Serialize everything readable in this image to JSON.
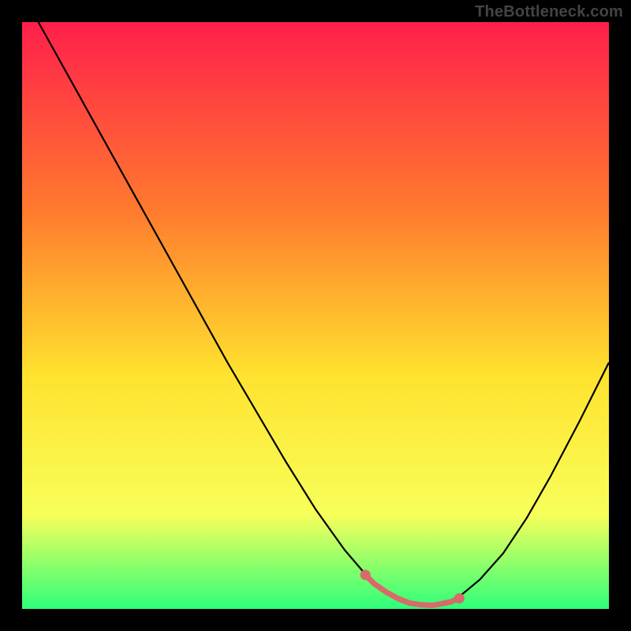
{
  "watermark": "TheBottleneck.com",
  "colors": {
    "background": "#000000",
    "gradient_top": "#ff1f4b",
    "gradient_mid1": "#ff7a2e",
    "gradient_mid2": "#ffe22e",
    "gradient_mid3": "#f7ff5a",
    "gradient_bottom": "#2eff7a",
    "curve": "#000000",
    "accent": "#d86a6a"
  },
  "chart_data": {
    "type": "line",
    "title": "",
    "xlabel": "",
    "ylabel": "",
    "xlim": [
      0,
      100
    ],
    "ylim": [
      0,
      100
    ],
    "curve_x": [
      0,
      5,
      10,
      15,
      20,
      25,
      30,
      35,
      40,
      45,
      50,
      55,
      58,
      60,
      63,
      66.5,
      70,
      73,
      75,
      78,
      82,
      86,
      90,
      95,
      100
    ],
    "curve_y": [
      105,
      96,
      87,
      78,
      69,
      60,
      51,
      42,
      33.5,
      25,
      17,
      10,
      6.5,
      4.3,
      2.2,
      0.9,
      0.6,
      1.2,
      2.5,
      5.0,
      9.5,
      15.5,
      22.5,
      32,
      42
    ],
    "accent_x": [
      58.5,
      60,
      62,
      64,
      66,
      68,
      70,
      71.5,
      73,
      74.5
    ],
    "accent_y": [
      5.8,
      4.3,
      2.9,
      1.8,
      1.0,
      0.7,
      0.6,
      0.9,
      1.2,
      1.8
    ],
    "accent_endpoints": [
      {
        "x": 58.5,
        "y": 5.8
      },
      {
        "x": 74.5,
        "y": 1.8
      }
    ]
  }
}
